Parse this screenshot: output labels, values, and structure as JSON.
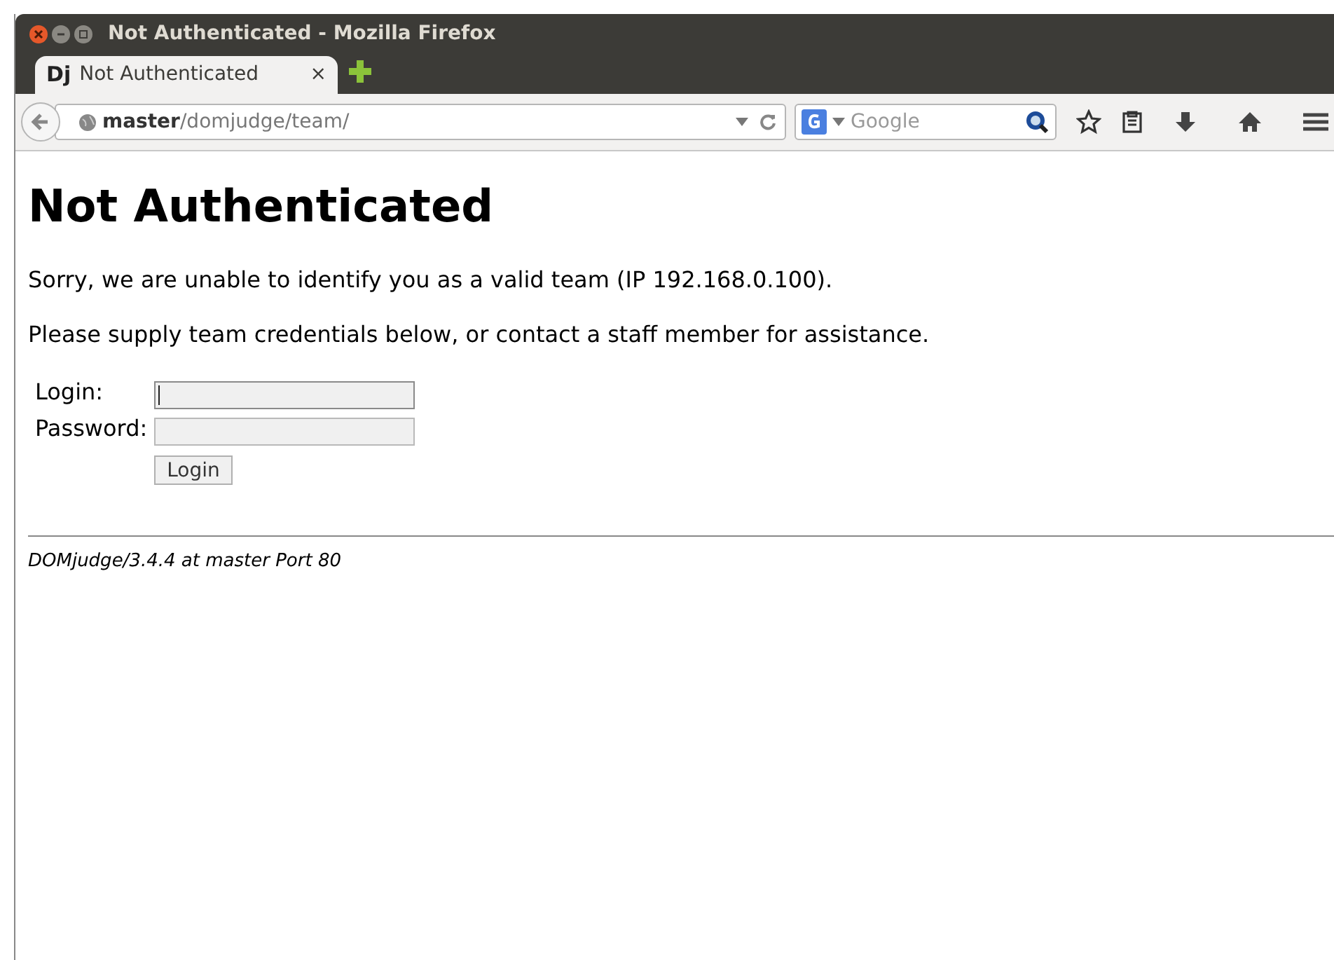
{
  "window": {
    "title": "Not Authenticated - Mozilla Firefox"
  },
  "tabs": [
    {
      "favicon": "Dj",
      "label": "Not Authenticated",
      "close": "×",
      "selected": true
    }
  ],
  "toolbar": {
    "url": "**master**/domjudge/team/",
    "search_placeholder": "Google"
  },
  "page": {
    "heading": "Not Authenticated",
    "paragraphs": [
      "Sorry, we are unable to identify you as a valid team (IP 192.168.0.100).",
      "Please supply team credentials below, or contact a staff member for assistance."
    ],
    "form": {
      "fields": [
        {
          "label": "Login:",
          "focused": true
        },
        {
          "label": "Password:",
          "focused": false
        }
      ],
      "button": "Login"
    },
    "footer": "DOMjudge/3.4.4 at master Port 80"
  }
}
